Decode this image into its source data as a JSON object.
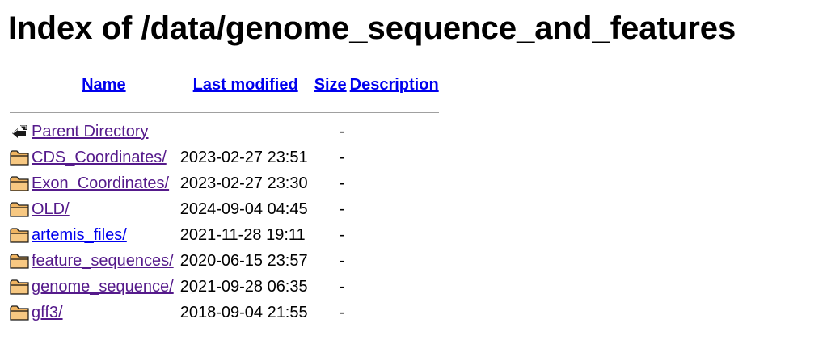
{
  "page": {
    "title": "Index of /data/genome_sequence_and_features"
  },
  "columns": {
    "name": "Name",
    "last_modified": "Last modified",
    "size": "Size",
    "description": "Description"
  },
  "entries": [
    {
      "name": "Parent Directory",
      "modified": "",
      "size": "-",
      "icon": "back-icon"
    },
    {
      "name": "CDS_Coordinates/",
      "modified": "2023-02-27 23:51",
      "size": "-",
      "icon": "folder-icon"
    },
    {
      "name": "Exon_Coordinates/",
      "modified": "2023-02-27 23:30",
      "size": "-",
      "icon": "folder-icon"
    },
    {
      "name": "OLD/",
      "modified": "2024-09-04 04:45",
      "size": "-",
      "icon": "folder-icon"
    },
    {
      "name": "artemis_files/",
      "modified": "2021-11-28 19:11",
      "size": "-",
      "icon": "folder-icon"
    },
    {
      "name": "feature_sequences/",
      "modified": "2020-06-15 23:57",
      "size": "-",
      "icon": "folder-icon"
    },
    {
      "name": "genome_sequence/",
      "modified": "2021-09-28 06:35",
      "size": "-",
      "icon": "folder-icon"
    },
    {
      "name": "gff3/",
      "modified": "2018-09-04 21:55",
      "size": "-",
      "icon": "folder-icon"
    }
  ],
  "colors": {
    "link_unvisited": "#0000ee",
    "link_visited": "#551a8b",
    "separator": "#a0a0a0",
    "folder_fill": "#f0b461"
  }
}
